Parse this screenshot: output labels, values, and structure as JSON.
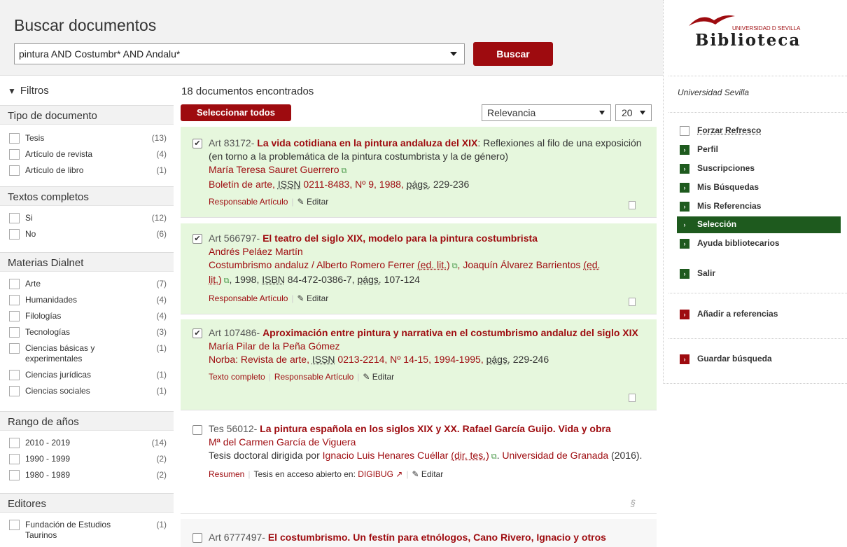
{
  "header": {
    "title": "Buscar documentos",
    "search_value": "pintura AND Costumbr* AND Andalu*",
    "search_button": "Buscar"
  },
  "filters": {
    "heading": "Filtros",
    "groups": [
      {
        "title": "Tipo de documento",
        "items": [
          {
            "label": "Tesis",
            "count": "(13)"
          },
          {
            "label": "Artículo de revista",
            "count": "(4)"
          },
          {
            "label": "Artículo de libro",
            "count": "(1)"
          }
        ]
      },
      {
        "title": "Textos completos",
        "items": [
          {
            "label": "Si",
            "count": "(12)"
          },
          {
            "label": "No",
            "count": "(6)"
          }
        ]
      },
      {
        "title": "Materias Dialnet",
        "items": [
          {
            "label": "Arte",
            "count": "(7)"
          },
          {
            "label": "Humanidades",
            "count": "(4)"
          },
          {
            "label": "Filologías",
            "count": "(4)"
          },
          {
            "label": "Tecnologías",
            "count": "(3)"
          },
          {
            "label": "Ciencias básicas y experimentales",
            "count": "(1)"
          },
          {
            "label": "Ciencias jurídicas",
            "count": "(1)"
          },
          {
            "label": "Ciencias sociales",
            "count": "(1)"
          }
        ]
      },
      {
        "title": "Rango de años",
        "items": [
          {
            "label": "2010 - 2019",
            "count": "(14)"
          },
          {
            "label": "1990 - 1999",
            "count": "(2)"
          },
          {
            "label": "1980 - 1989",
            "count": "(2)"
          }
        ]
      },
      {
        "title": "Editores",
        "items": [
          {
            "label": "Fundación de Estudios Taurinos",
            "count": "(1)"
          }
        ]
      }
    ]
  },
  "results": {
    "count_text": "18 documentos encontrados",
    "select_all": "Seleccionar todos",
    "sort_value": "Relevancia",
    "per_page": "20",
    "records": [
      {
        "type": "Art 83172- ",
        "title": "La vida cotidiana en la pintura andaluza del XIX",
        "title_rest": ": Reflexiones al filo de una exposición (en torno a la problemática de la pintura costumbrista y la de género)",
        "author": "María Teresa Sauret Guerrero",
        "source": "Boletín de arte, ",
        "issn_label": "ISSN",
        "source2": " 0211-8483, Nº 9, 1988, ",
        "pags": "págs.",
        "pages": " 229-236",
        "actions": [
          "Responsable Artículo",
          "Editar"
        ]
      },
      {
        "type": "Art 566797- ",
        "title": "El teatro del siglo XIX, modelo para la pintura costumbrista",
        "author": "Andrés Peláez Martín",
        "line1a": "Costumbrismo andaluz / Alberto Romero Ferrer ",
        "edlit": "(ed. lit.)",
        "line1b": ", Joaquín Álvarez Barrientos ",
        "edlit2": "(ed.",
        "line2a": "lit.)",
        "line2b": ", 1998, ",
        "isbn": "ISBN",
        "line2c": " 84-472-0386-7, ",
        "pags": "págs.",
        "pages": " 107-124",
        "actions": [
          "Responsable Artículo",
          "Editar"
        ]
      },
      {
        "type": "Art 107486- ",
        "title": "Aproximación entre pintura y narrativa en el costumbrismo andaluz del siglo XIX",
        "author": "María Pilar de la Peña Gómez",
        "source": "Norba: Revista de arte, ",
        "issn_label": "ISSN",
        "source2": " 0213-2214, Nº 14-15, 1994-1995, ",
        "pags": "págs.",
        "pages": " 229-246",
        "actions": [
          "Texto completo",
          "Responsable Artículo",
          "Editar"
        ]
      },
      {
        "type": "Tes 56012- ",
        "title": "La pintura española en los siglos XIX y XX. Rafael García Guijo. Vida y obra",
        "author": "Mª del Carmen García de Viguera",
        "l1": "Tesis doctoral dirigida por ",
        "dir": "Ignacio Luis Henares Cuéllar",
        "dirtes": "(dir. tes.)",
        "l2": ". ",
        "univ": "Universidad de Granada",
        "year": " (2016).",
        "actions": [
          "Resumen",
          "Tesis en acceso abierto en: ",
          "DIGIBUG",
          "Editar"
        ]
      },
      {
        "type": "Art 6777497- ",
        "title": "El costumbrismo. Un festín para etnólogos, Cano Rivero, Ignacio y otros"
      }
    ]
  },
  "right": {
    "logo_sub": "UNIVERSIDAD D SEVILLA",
    "logo_main": "Biblioteca",
    "university": "Universidad Sevilla",
    "menu": [
      "Forzar Refresco",
      "Perfil",
      "Suscripciones",
      "Mis Búsquedas",
      "Mis Referencias",
      "Selección",
      "Ayuda bibliotecarios",
      "Salir"
    ],
    "add_refs": "Añadir a referencias",
    "save_search": "Guardar búsqueda"
  },
  "colors": {
    "brand": "#9e0b0f",
    "green": "#1e5a1e",
    "selected_bg": "#e6f7dd"
  }
}
